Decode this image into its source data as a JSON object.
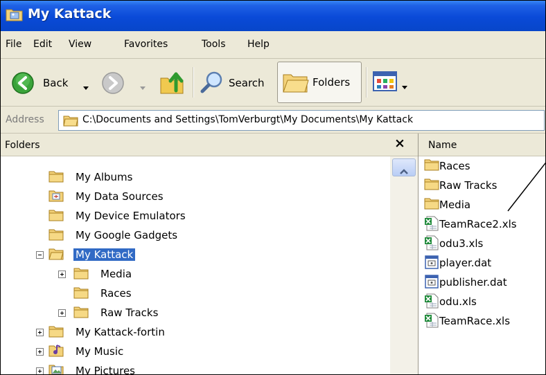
{
  "window": {
    "title": "My Kattack"
  },
  "menu": [
    "File",
    "Edit",
    "View",
    "Favorites",
    "Tools",
    "Help"
  ],
  "toolbar": {
    "back_label": "Back",
    "search_label": "Search",
    "folders_label": "Folders"
  },
  "address": {
    "label": "Address",
    "path": "C:\\Documents and Settings\\TomVerburgt\\My Documents\\My Kattack"
  },
  "folders_pane": {
    "title": "Folders",
    "close_glyph": "×",
    "items": [
      {
        "label": "My Albums",
        "icon": "folder-icon"
      },
      {
        "label": "My Data Sources",
        "icon": "data-sources-folder-icon"
      },
      {
        "label": "My Device Emulators",
        "icon": "folder-icon"
      },
      {
        "label": "My Google Gadgets",
        "icon": "folder-icon"
      },
      {
        "label": "My Kattack",
        "icon": "open-folder-icon",
        "selected": true,
        "expander": "minus"
      },
      {
        "label": "Media",
        "icon": "folder-icon",
        "expander": "plus"
      },
      {
        "label": "Races",
        "icon": "folder-icon"
      },
      {
        "label": "Raw Tracks",
        "icon": "folder-icon",
        "expander": "plus"
      },
      {
        "label": "My Kattack-fortin",
        "icon": "folder-icon",
        "expander": "plus"
      },
      {
        "label": "My Music",
        "icon": "music-folder-icon",
        "expander": "plus"
      },
      {
        "label": "My Pictures",
        "icon": "pictures-folder-icon",
        "expander": "plus"
      }
    ]
  },
  "list_pane": {
    "column_name": "Name",
    "files": [
      {
        "label": "Races",
        "icon": "folder-icon"
      },
      {
        "label": "Raw Tracks",
        "icon": "folder-icon"
      },
      {
        "label": "Media",
        "icon": "folder-icon"
      },
      {
        "label": "TeamRace2.xls",
        "icon": "excel-file-icon"
      },
      {
        "label": "odu3.xls",
        "icon": "excel-file-icon"
      },
      {
        "label": "player.dat",
        "icon": "dat-file-icon"
      },
      {
        "label": "publisher.dat",
        "icon": "dat-file-icon"
      },
      {
        "label": "odu.xls",
        "icon": "excel-file-icon"
      },
      {
        "label": "TeamRace.xls",
        "icon": "excel-file-icon"
      }
    ]
  },
  "colors": {
    "title_bar": "#0a4ad8",
    "selection": "#316ac5",
    "chrome": "#ece9d8"
  }
}
